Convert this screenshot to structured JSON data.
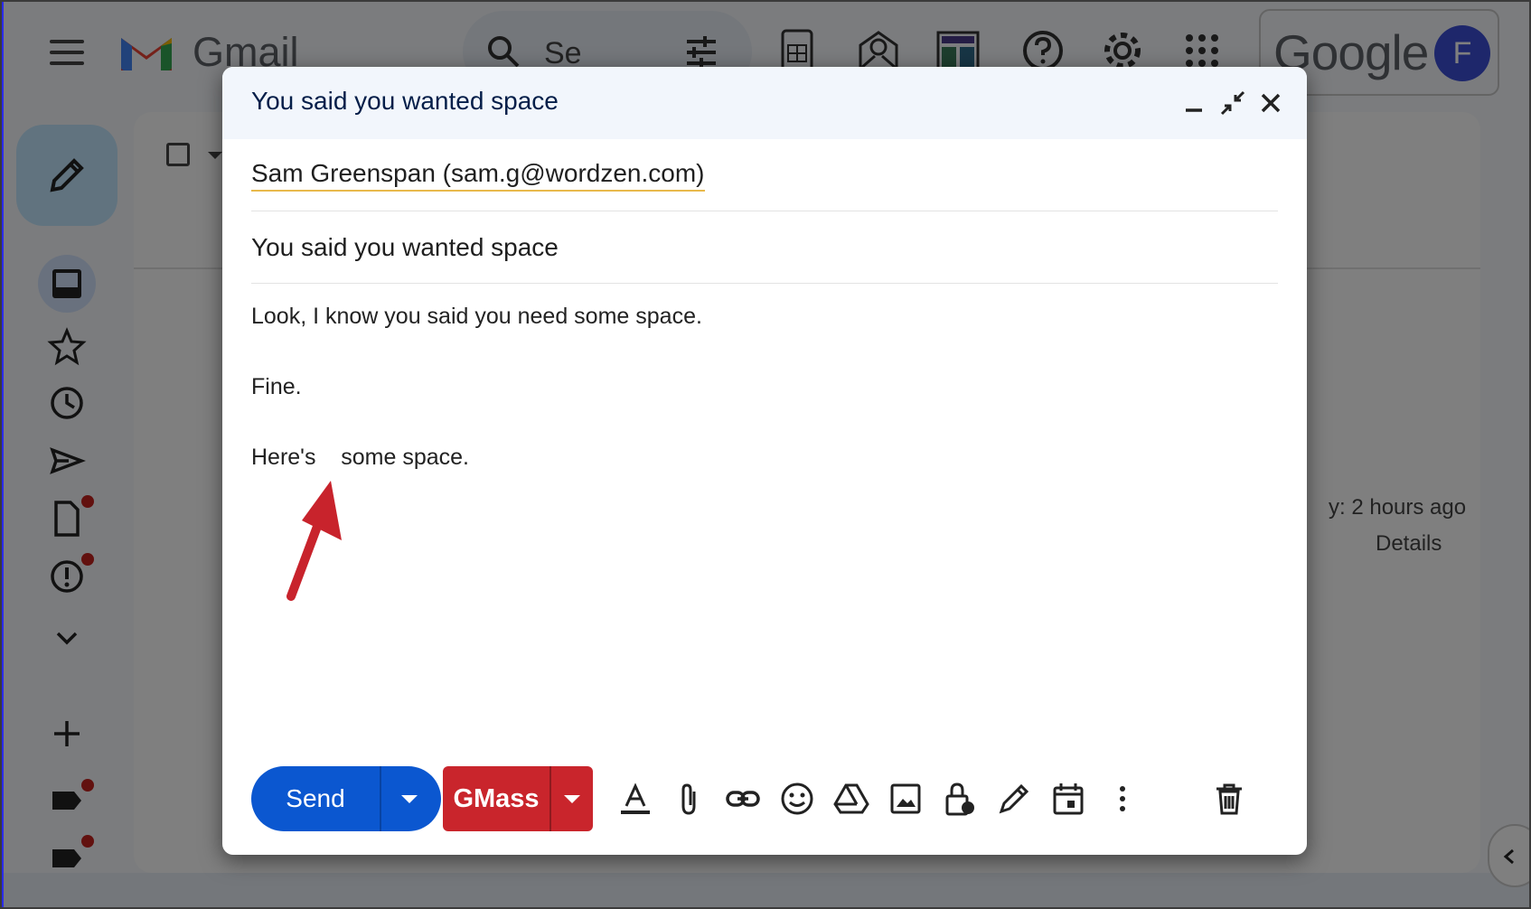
{
  "app": {
    "name": "Gmail",
    "search_placeholder": "Se",
    "brand_word": "Google",
    "avatar_letter": "F"
  },
  "colors": {
    "accent": "#0b57d0",
    "gmass": "#c9252c",
    "header_bg": "#f2f6fc",
    "arrow": "#c8232c"
  },
  "background": {
    "time_text": "y: 2 hours ago",
    "details_label": "Details"
  },
  "compose": {
    "title": "You said you wanted space",
    "recipient": "Sam Greenspan (sam.g@wordzen.com)",
    "subject": "You said you wanted space",
    "body": {
      "line1": "Look, I know you said you need some space.",
      "line2": "Fine.",
      "line3": "Here's    some space."
    },
    "send_label": "Send",
    "gmass_label": "GMass"
  },
  "icons": {
    "header": [
      "minimize-icon",
      "exit-fullscreen-icon",
      "close-icon"
    ],
    "toolbar": [
      "text-format-icon",
      "attach-icon",
      "link-icon",
      "emoji-icon",
      "drive-icon",
      "photo-icon",
      "confidential-icon",
      "signature-icon",
      "schedule-icon",
      "more-options-icon",
      "trash-icon"
    ],
    "sidebar": [
      "compose-pencil-icon",
      "inbox-icon",
      "star-icon",
      "snooze-icon",
      "sent-icon",
      "drafts-icon",
      "spam-icon",
      "more-chevron-icon",
      "add-label-icon",
      "label-icon",
      "label-icon"
    ]
  }
}
